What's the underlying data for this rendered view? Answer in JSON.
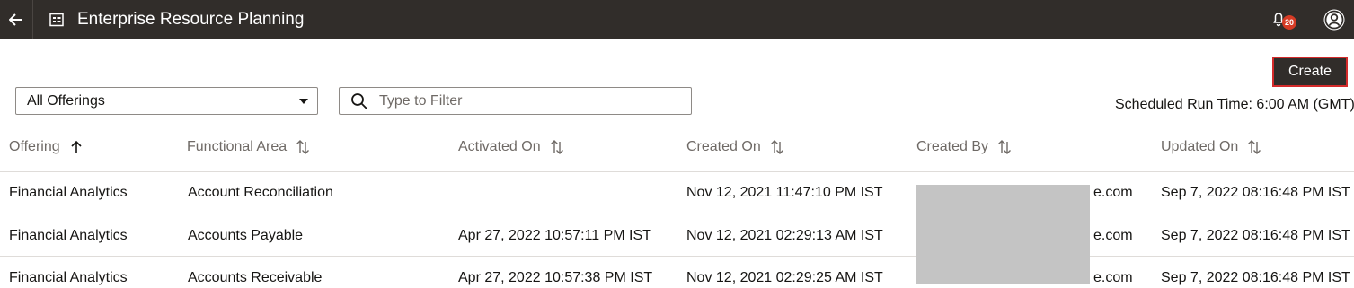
{
  "header": {
    "title": "Enterprise Resource Planning",
    "notification_count": "20"
  },
  "toolbar": {
    "create_label": "Create",
    "scheduled_run": "Scheduled Run Time: 6:00 AM (GMT)"
  },
  "filters": {
    "offering_select": "All Offerings",
    "filter_placeholder": "Type to Filter"
  },
  "table": {
    "columns": [
      "Offering",
      "Functional Area",
      "Activated On",
      "Created On",
      "Created By",
      "Updated On"
    ],
    "rows": [
      [
        "Financial Analytics",
        "Account Reconciliation",
        "",
        "Nov 12, 2021 11:47:10 PM IST",
        "e.com",
        "Sep 7, 2022 08:16:48 PM IST"
      ],
      [
        "Financial Analytics",
        "Accounts Payable",
        "Apr 27, 2022 10:57:11 PM IST",
        "Nov 12, 2021 02:29:13 AM IST",
        "e.com",
        "Sep 7, 2022 08:16:48 PM IST"
      ],
      [
        "Financial Analytics",
        "Accounts Receivable",
        "Apr 27, 2022 10:57:38 PM IST",
        "Nov 12, 2021 02:29:25 AM IST",
        "e.com",
        "Sep 7, 2022 08:16:48 PM IST"
      ]
    ]
  },
  "colors": {
    "topbar": "#312d2a",
    "create_border": "#d42b2b",
    "badge": "#d63b25"
  }
}
